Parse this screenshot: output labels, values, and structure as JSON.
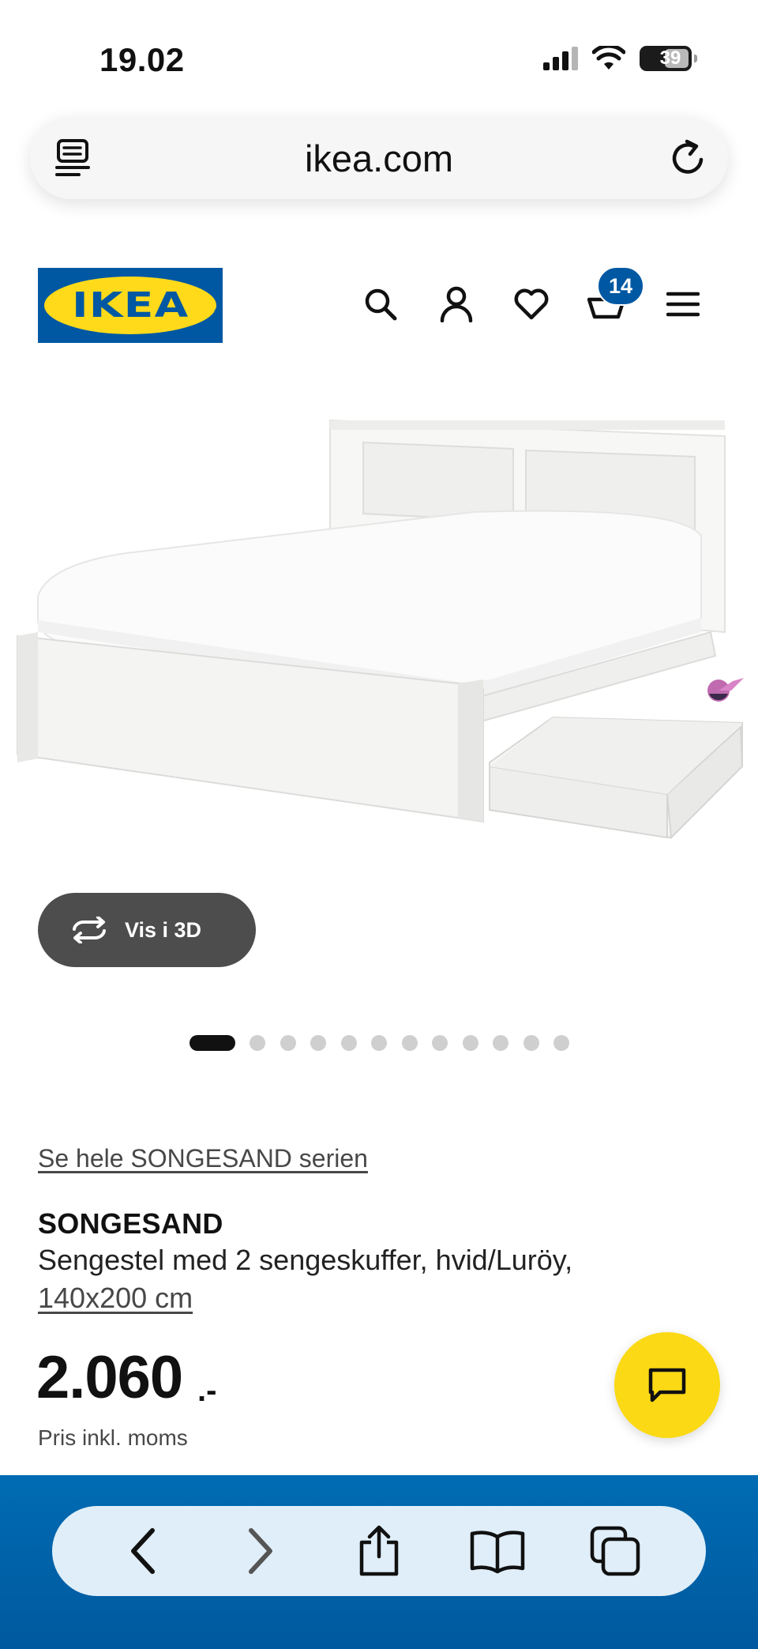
{
  "status_bar": {
    "time": "19.02",
    "battery": "39"
  },
  "browser": {
    "url": "ikea.com"
  },
  "header": {
    "logo_text": "IKEA",
    "cart_count": "14"
  },
  "product": {
    "view_3d_label": "Vis i 3D",
    "image_count": 12,
    "active_image": 1,
    "series_link": "Se hele SONGESAND serien",
    "name": "SONGESAND",
    "description": "Sengestel med 2 sengeskuffer, hvid/Luröy,",
    "size": "140x200 cm",
    "price": "2.060",
    "price_suffix": ".-",
    "price_note": "Pris inkl. moms"
  },
  "colors": {
    "brand_blue": "#0058a3",
    "brand_yellow": "#ffda1a",
    "chat_yellow": "#fbd914"
  }
}
